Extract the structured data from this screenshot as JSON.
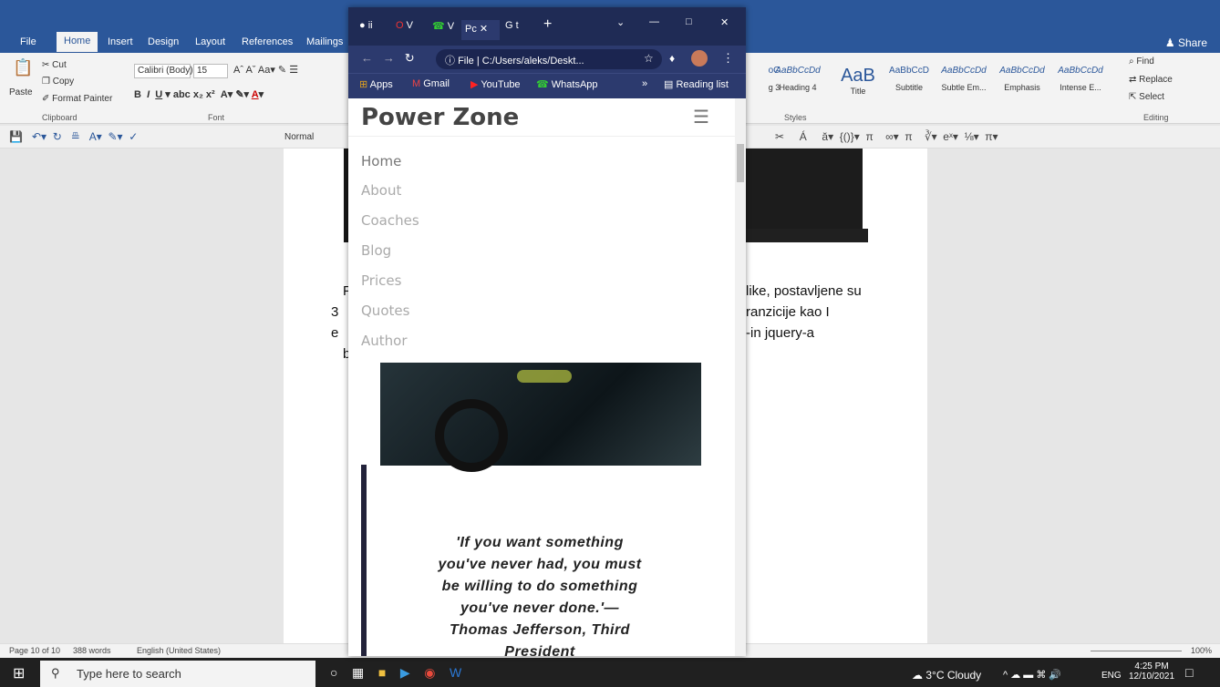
{
  "word": {
    "tabs": [
      "File",
      "Home",
      "Insert",
      "Design",
      "Layout",
      "References",
      "Mailings"
    ],
    "share": "Share",
    "clipboard": {
      "paste": "Paste",
      "cut": "Cut",
      "copy": "Copy",
      "format_painter": "Format Painter",
      "label": "Clipboard"
    },
    "font": {
      "family": "Calibri (Body)",
      "size": "15",
      "label": "Font"
    },
    "styles": {
      "label": "Styles",
      "items": [
        {
          "sample": "oC",
          "name": "g 3"
        },
        {
          "sample": "AaBbCcDd",
          "name": "Heading 4"
        },
        {
          "sample": "AaB",
          "name": "Title"
        },
        {
          "sample": "AaBbCcD",
          "name": "Subtitle"
        },
        {
          "sample": "AaBbCcDd",
          "name": "Subtle Em..."
        },
        {
          "sample": "AaBbCcDd",
          "name": "Emphasis"
        },
        {
          "sample": "AaBbCcDd",
          "name": "Intense E..."
        }
      ]
    },
    "editing": {
      "find": "Find",
      "replace": "Replace",
      "select": "Select",
      "label": "Editing"
    },
    "style_box": "Normal",
    "doc_lines": {
      "l1": "like, postavljene su",
      "l2": "ranzicije kao I",
      "l3": "-in jquery-a",
      "c1": "F",
      "c2": "3",
      "c3": "e",
      "c4": "b"
    },
    "status": {
      "page": "Page 10 of 10",
      "words": "388 words",
      "lang": "English (United States)",
      "zoom": "100%"
    }
  },
  "chrome": {
    "address": "File | C:/Users/aleks/Deskt...",
    "bookmarks": [
      "Apps",
      "Gmail",
      "YouTube",
      "WhatsApp"
    ],
    "reading_list": "Reading list",
    "tabs": [
      "ii",
      "V",
      "V",
      "Pc",
      "t"
    ]
  },
  "site": {
    "title": "Power Zone",
    "nav": [
      "Home",
      "About",
      "Coaches",
      "Blog",
      "Prices",
      "Quotes",
      "Author"
    ],
    "quote": "'If you want something you've never had, you must be willing to do something you've never done.'— Thomas Jefferson, Third President"
  },
  "taskbar": {
    "search": "Type here to search",
    "weather": "3°C Cloudy",
    "lang": "ENG",
    "time": "4:25 PM",
    "date": "12/10/2021"
  }
}
